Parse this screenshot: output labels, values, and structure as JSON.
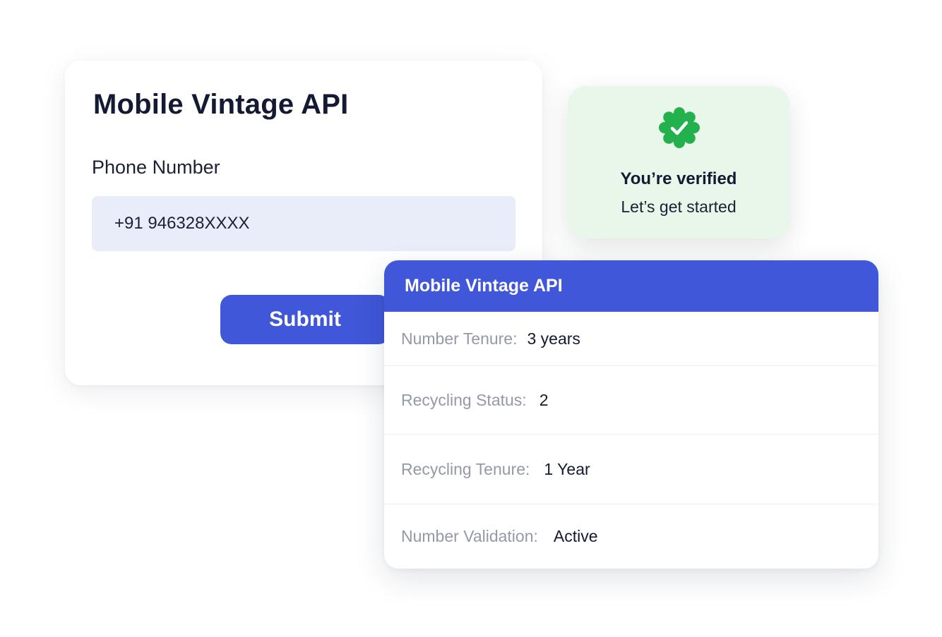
{
  "form": {
    "title": "Mobile Vintage API",
    "phone_label": "Phone Number",
    "phone_value": "+91 946328XXXX",
    "submit_label": "Submit"
  },
  "verified": {
    "icon": "verified-badge-icon",
    "title": "You’re verified",
    "subtitle": "Let’s get started",
    "color": "#22b14c"
  },
  "result": {
    "title": "Mobile Vintage API",
    "rows": [
      {
        "label": "Number Tenure:",
        "value": "3 years"
      },
      {
        "label": "Recycling Status:",
        "value": "2"
      },
      {
        "label": "Recycling Tenure:",
        "value": "1 Year"
      },
      {
        "label": "Number Validation:",
        "value": "Active"
      }
    ]
  },
  "colors": {
    "accent": "#3f57d8",
    "input_bg": "#e9ecf9",
    "verified_bg": "#e9f6ea",
    "muted_text": "#9499a8"
  }
}
